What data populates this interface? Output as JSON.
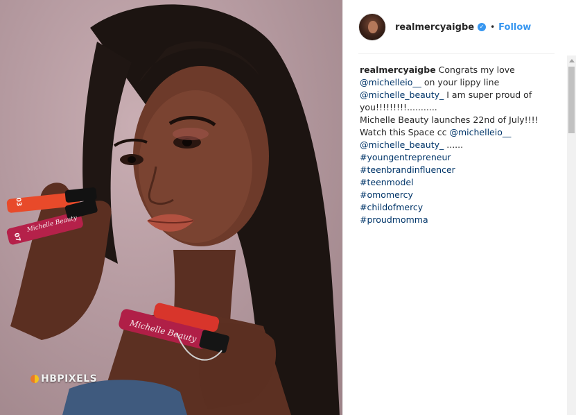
{
  "photo": {
    "watermark": "HBPIXELS",
    "product_labels": [
      "03",
      "07",
      "Michelle Beauty",
      "Michelle Beauty"
    ]
  },
  "post": {
    "username": "realmercyaigbe",
    "separator": "•",
    "follow_label": "Follow",
    "caption": {
      "author": "realmercyaigbe",
      "line1_text": "Congrats my love",
      "mention1": "@michelleio__",
      "line2_text": "on your lippy line",
      "mention2": "@michelle_beauty_",
      "line3_text": "I am super proud of",
      "line4": "you!!!!!!!!!...........",
      "line5": "Michelle Beauty launches 22nd of July!!!!",
      "line6_text": "Watch this Space cc",
      "mention3": "@michelleio__",
      "mention4": "@michelle_beauty_",
      "line7_text": "......",
      "hashtags": [
        "#youngentrepreneur",
        "#teenbrandinfluencer",
        "#teenmodel",
        "#omomercy",
        "#childofmercy",
        "#proudmomma"
      ]
    }
  },
  "colors": {
    "accent": "#3897f0",
    "link": "#003569",
    "text": "#262626"
  },
  "icons": {
    "verified": "verified-badge-icon",
    "scroll_up": "scroll-up-arrow-icon"
  }
}
